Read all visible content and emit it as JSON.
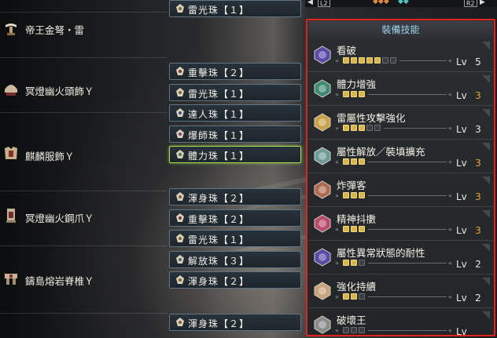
{
  "top_bar": {
    "left_button": "L2",
    "right_button": "R2"
  },
  "equipment": [
    {
      "name": "",
      "icon": "weapon-icon"
    },
    {
      "name": "帝王金弩・雷",
      "icon": "bow-gun-icon"
    },
    {
      "name": "冥燈幽火頭飾Ｙ",
      "icon": "helmet-icon"
    },
    {
      "name": "麒麟服飾Ｙ",
      "icon": "chest-armor-icon"
    },
    {
      "name": "冥燈幽火鋼爪Ｙ",
      "icon": "arm-armor-icon"
    },
    {
      "name": "鑄島熔岩脊椎Ｙ",
      "icon": "waist-armor-icon"
    },
    {
      "name": "",
      "icon": "leg-armor-icon"
    }
  ],
  "decorations": [
    {
      "label": "雷光珠【１】",
      "selected": false
    },
    {
      "label": "重擊珠【２】",
      "selected": false
    },
    {
      "label": "雷光珠【１】",
      "selected": false
    },
    {
      "label": "達人珠【１】",
      "selected": false
    },
    {
      "label": "爆師珠【１】",
      "selected": false
    },
    {
      "label": "體力珠【１】",
      "selected": true
    },
    {
      "label": "渾身珠【２】",
      "selected": false
    },
    {
      "label": "重擊珠【２】",
      "selected": false
    },
    {
      "label": "雷光珠【１】",
      "selected": false
    },
    {
      "label": "解放珠【３】",
      "selected": false
    },
    {
      "label": "渾身珠【２】",
      "selected": false
    },
    {
      "label": "渾身珠【２】",
      "selected": false
    }
  ],
  "skills_panel": {
    "title": "裝備技能",
    "skills": [
      {
        "name": "看破",
        "lv_label": "Lv",
        "level": "5",
        "filled": 5,
        "max": 7,
        "color": "#5a4aa8",
        "highlight": false
      },
      {
        "name": "體力增強",
        "lv_label": "Lv",
        "level": "3",
        "filled": 3,
        "max": 3,
        "color": "#3f8a73",
        "highlight": true
      },
      {
        "name": "雷屬性攻擊強化",
        "lv_label": "Lv",
        "level": "3",
        "filled": 3,
        "max": 5,
        "color": "#c9a34a",
        "highlight": false
      },
      {
        "name": "屬性解放／裝填擴充",
        "lv_label": "Lv",
        "level": "3",
        "filled": 3,
        "max": 3,
        "color": "#6f9a9a",
        "highlight": true
      },
      {
        "name": "炸彈客",
        "lv_label": "Lv",
        "level": "3",
        "filled": 3,
        "max": 3,
        "color": "#b06a52",
        "highlight": true
      },
      {
        "name": "精神抖擻",
        "lv_label": "Lv",
        "level": "3",
        "filled": 3,
        "max": 3,
        "color": "#b84a6a",
        "highlight": true
      },
      {
        "name": "屬性異常狀態的耐性",
        "lv_label": "Lv",
        "level": "2",
        "filled": 2,
        "max": 3,
        "color": "#5a4aa8",
        "highlight": false
      },
      {
        "name": "強化持續",
        "lv_label": "Lv",
        "level": "2",
        "filled": 2,
        "max": 3,
        "color": "#c9a37a",
        "highlight": false
      },
      {
        "name": "破壞王",
        "lv_label": "Lv",
        "level": "",
        "filled": 0,
        "max": 3,
        "color": "#8a8a8a",
        "highlight": false
      }
    ]
  }
}
